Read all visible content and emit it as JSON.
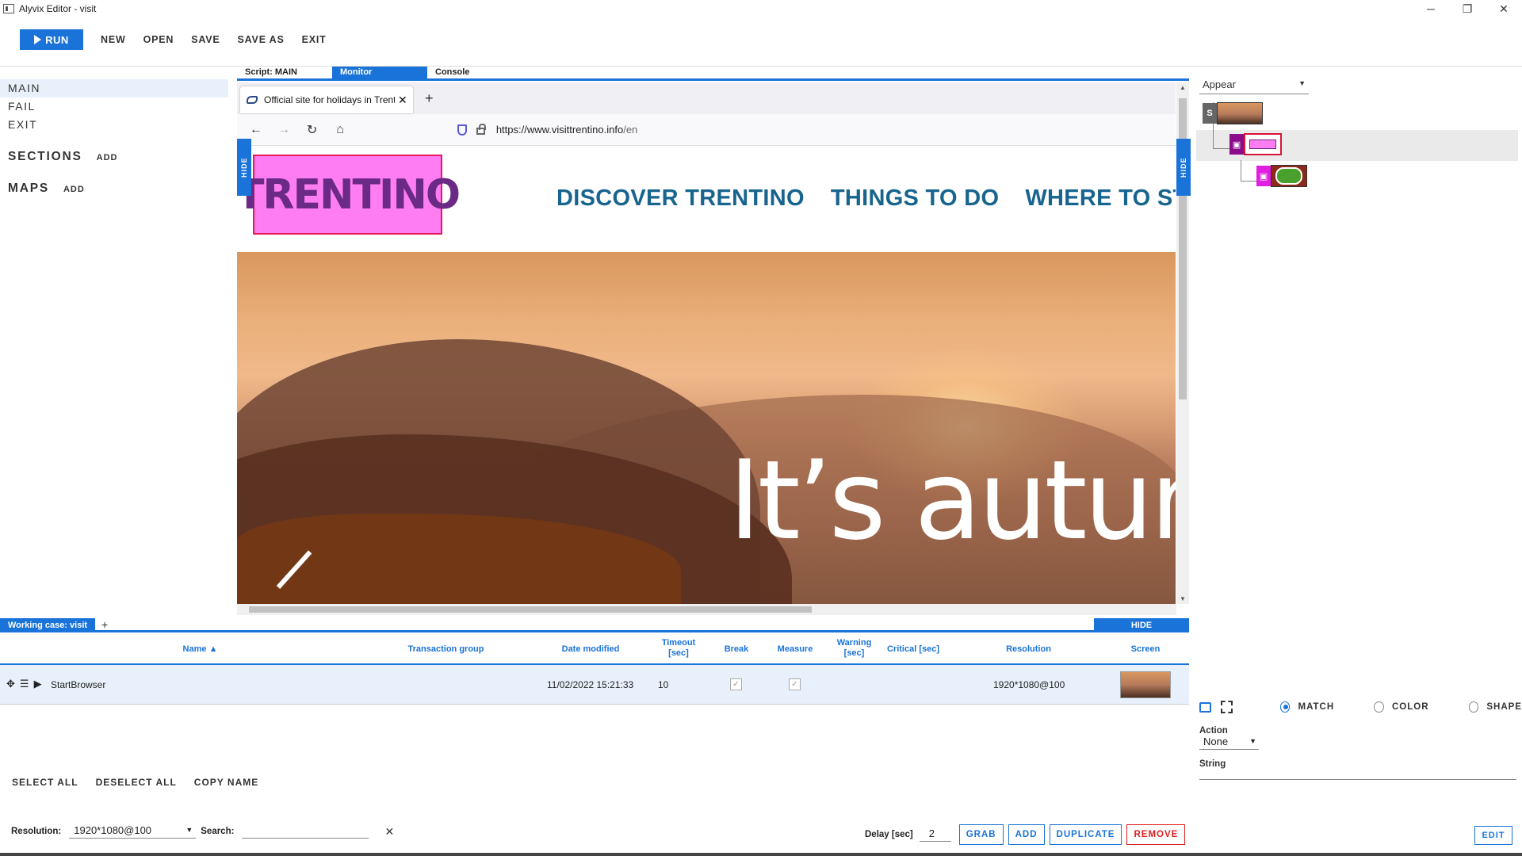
{
  "window": {
    "title": "Alyvix Editor - visit",
    "controls": [
      "─",
      "❐",
      "✕"
    ]
  },
  "toolbar": {
    "run_label": "RUN",
    "items": [
      "NEW",
      "OPEN",
      "SAVE",
      "SAVE AS",
      "EXIT"
    ]
  },
  "left_panel": {
    "scripts": [
      "MAIN",
      "FAIL",
      "EXIT"
    ],
    "sections_label": "SECTIONS",
    "sections_add": "ADD",
    "maps_label": "MAPS",
    "maps_add": "ADD"
  },
  "center_tabs": [
    "Script: MAIN",
    "Monitor",
    "Console"
  ],
  "side_hide_label": "HIDE",
  "browser": {
    "tab_title": "Official site for holidays in Trentino",
    "tab_close": "✕",
    "new_tab": "+",
    "url_host": "https://www.visittrentino.info",
    "url_path": "/en",
    "logo_text": "TRENTINO",
    "nav": [
      "DISCOVER TRENTINO",
      "THINGS TO DO",
      "WHERE TO STAY"
    ],
    "hero_text": "It’s autum"
  },
  "right_panel": {
    "method_select": "Appear",
    "root_badge": "S",
    "options": [
      "MATCH",
      "COLOR",
      "SHAPE"
    ],
    "selected_option": "MATCH",
    "action_label": "Action",
    "action_value": "None",
    "string_label": "String",
    "edit_label": "EDIT"
  },
  "working_case": {
    "label": "Working case: visit",
    "add": "+",
    "hide": "HIDE"
  },
  "grid": {
    "columns": [
      "Name ▲",
      "Transaction group",
      "Date modified",
      "Timeout [sec]",
      "Break",
      "Measure",
      "Warning [sec]",
      "Critical [sec]",
      "Resolution",
      "Screen"
    ],
    "rows": [
      {
        "name": "StartBrowser",
        "transaction_group": "",
        "date_modified": "11/02/2022 15:21:33",
        "timeout": "10",
        "break": true,
        "measure": true,
        "warning": "",
        "critical": "",
        "resolution": "1920*1080@100"
      }
    ]
  },
  "selection_actions": [
    "SELECT ALL",
    "DESELECT ALL",
    "COPY NAME"
  ],
  "filter": {
    "resolution_label": "Resolution:",
    "resolution_value": "1920*1080@100",
    "search_label": "Search:",
    "search_value": "",
    "clear": "✕"
  },
  "object_actions": {
    "delay_label": "Delay [sec]",
    "delay_value": "2",
    "buttons": [
      "GRAB",
      "ADD",
      "DUPLICATE",
      "REMOVE"
    ]
  },
  "colors": {
    "accent": "#1a73d9",
    "remove": "#e02020",
    "site_nav": "#17648f",
    "logo_bg": "#ff7df2"
  }
}
